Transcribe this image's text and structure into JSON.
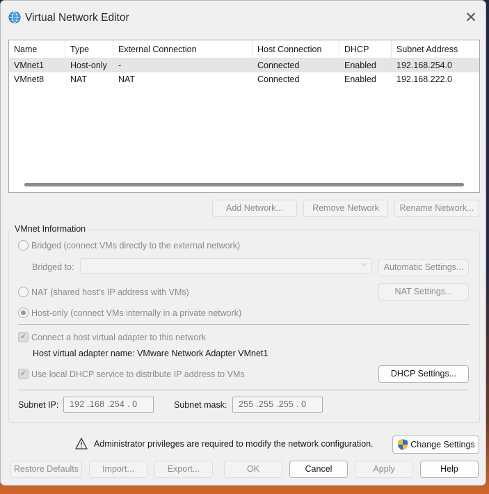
{
  "window": {
    "title": "Virtual Network Editor"
  },
  "table": {
    "columns": [
      "Name",
      "Type",
      "External Connection",
      "Host Connection",
      "DHCP",
      "Subnet Address"
    ],
    "rows": [
      [
        "VMnet1",
        "Host-only",
        "-",
        "Connected",
        "Enabled",
        "192.168.254.0"
      ],
      [
        "VMnet8",
        "NAT",
        "NAT",
        "Connected",
        "Enabled",
        "192.168.222.0"
      ]
    ]
  },
  "list_buttons": {
    "add": "Add Network...",
    "remove": "Remove Network",
    "rename": "Rename Network..."
  },
  "vmnet_info": {
    "group_title": "VMnet Information",
    "bridged_label": "Bridged (connect VMs directly to the external network)",
    "bridged_to_label": "Bridged to:",
    "bridged_to_value": "",
    "automatic_settings": "Automatic Settings...",
    "nat_label": "NAT (shared host's IP address with VMs)",
    "nat_settings": "NAT Settings...",
    "hostonly_label": "Host-only (connect VMs internally in a private network)",
    "connect_adapter_label": "Connect a host virtual adapter to this network",
    "adapter_name_text": "Host virtual adapter name: VMware Network Adapter VMnet1",
    "dhcp_label": "Use local DHCP service to distribute IP address to VMs",
    "dhcp_settings": "DHCP Settings...",
    "subnet_ip_label": "Subnet IP:",
    "subnet_ip_value": "192 .168 .254 .  0",
    "subnet_mask_label": "Subnet mask:",
    "subnet_mask_value": "255 .255 .255 .  0"
  },
  "admin": {
    "message": "Administrator privileges are required to modify the network configuration.",
    "change_settings": "Change Settings"
  },
  "footer": {
    "restore_defaults": "Restore Defaults",
    "import": "Import...",
    "export": "Export...",
    "ok": "OK",
    "cancel": "Cancel",
    "apply": "Apply",
    "help": "Help"
  },
  "icons": {
    "app": "globe-network-icon",
    "close": "close-icon",
    "warning": "warning-triangle-icon",
    "uac": "uac-shield-icon",
    "dropdown": "chevron-down-icon"
  },
  "colors": {
    "window_bg": "#f0f0f0",
    "selected_row": "#e5e5e5",
    "shield_blue": "#2c6fd1",
    "shield_yellow": "#f2c230"
  }
}
